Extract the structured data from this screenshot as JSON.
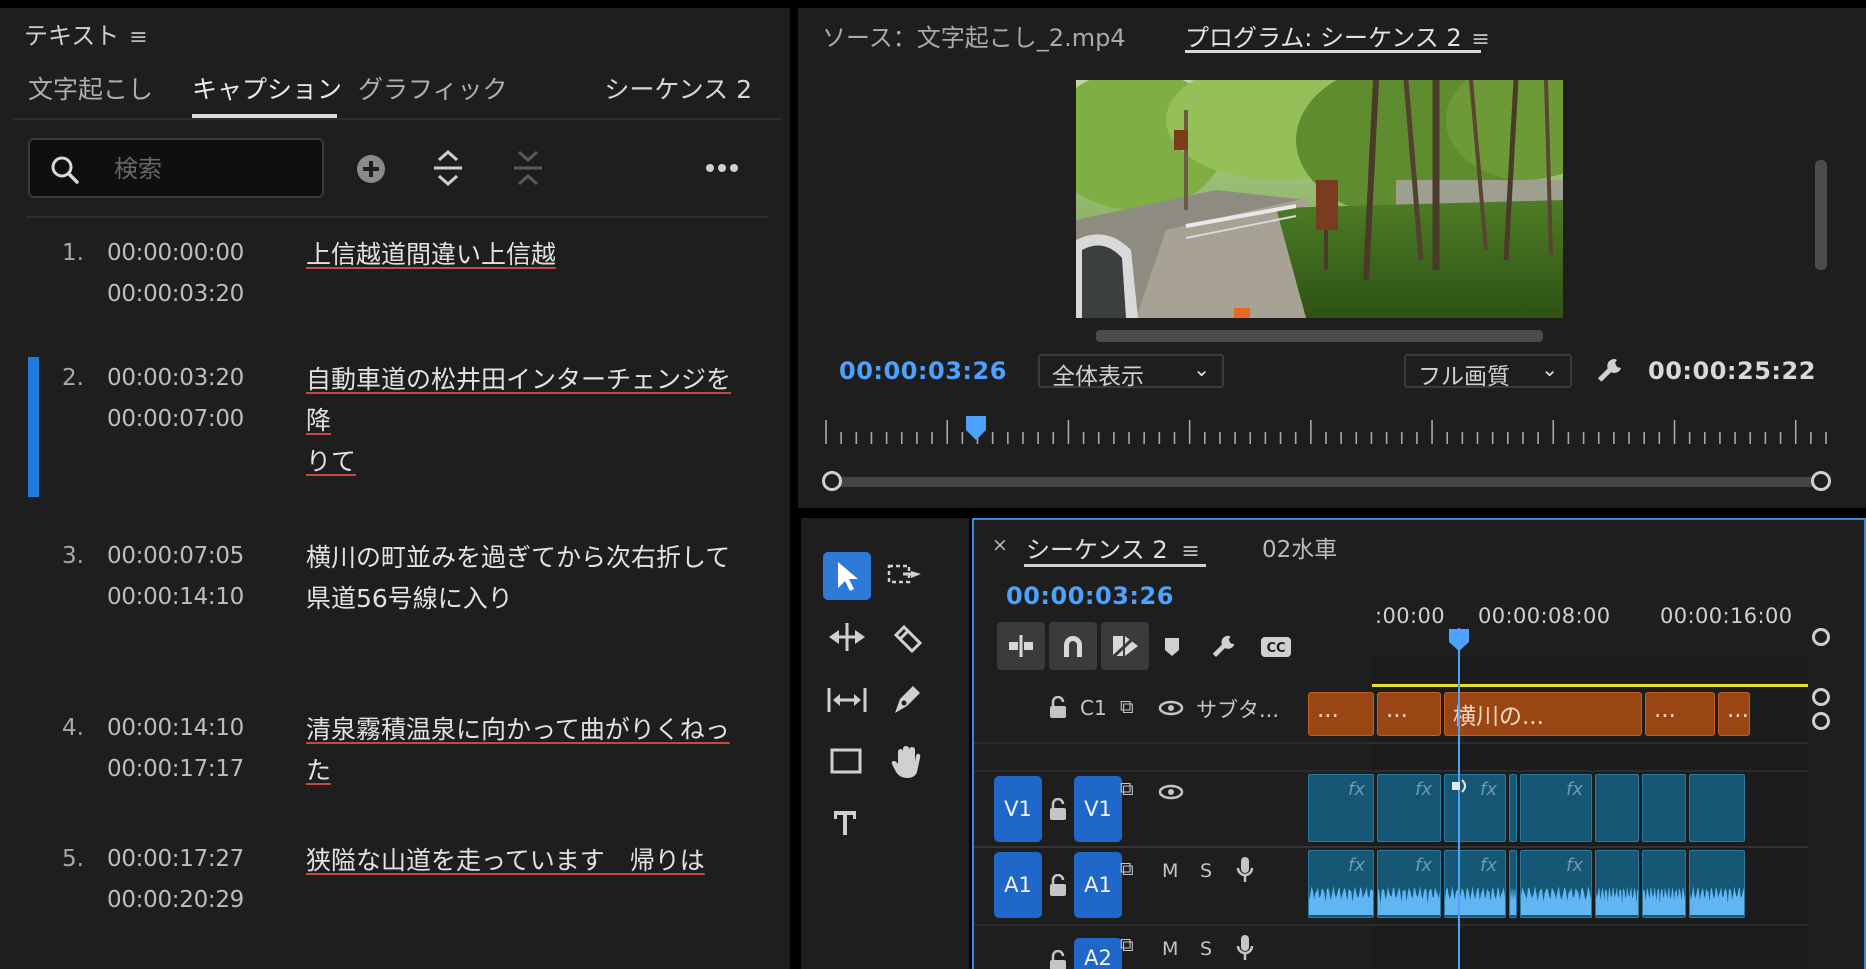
{
  "text_panel": {
    "title": "テキスト",
    "tabs": [
      "文字起こし",
      "キャプション",
      "グラフィック"
    ],
    "active_tab": "キャプション",
    "sequence_name": "シーケンス 2",
    "search": {
      "placeholder": "検索",
      "value": ""
    },
    "captions": [
      {
        "num": "1.",
        "start": "00:00:00:00",
        "end": "00:00:03:20",
        "lines": [
          "上信越道間違い上信越"
        ],
        "underlined": true,
        "selected": false
      },
      {
        "num": "2.",
        "start": "00:00:03:20",
        "end": "00:00:07:00",
        "lines": [
          "自動車道の松井田インターチェンジを降",
          "りて"
        ],
        "underlined": true,
        "selected": true
      },
      {
        "num": "3.",
        "start": "00:00:07:05",
        "end": "00:00:14:10",
        "lines": [
          "横川の町並みを過ぎてから次右折して",
          "県道56号線に入り"
        ],
        "underlined": false,
        "selected": false
      },
      {
        "num": "4.",
        "start": "00:00:14:10",
        "end": "00:00:17:17",
        "lines": [
          "清泉霧積温泉に向かって曲がりくねった"
        ],
        "underlined": true,
        "selected": false
      },
      {
        "num": "5.",
        "start": "00:00:17:27",
        "end": "00:00:20:29",
        "lines": [
          "狭隘な山道を走っています　帰りは"
        ],
        "underlined": true,
        "selected": false
      }
    ]
  },
  "program_monitor": {
    "source_tab": "ソース：文字起こし_2.mp4",
    "program_tab": "プログラム: シーケンス 2",
    "current_tc": "00:00:03:26",
    "zoom": "全体表示",
    "quality": "フル画質",
    "duration_tc": "00:00:25:22",
    "playhead_fraction": 0.15
  },
  "timeline": {
    "tab_name": "シーケンス 2",
    "other_tab": "02水車",
    "current_tc": "00:00:03:26",
    "ruler_labels": [
      ":00:00",
      "00:00:08:00",
      "00:00:16:00"
    ],
    "caption_track": {
      "name": "C1",
      "label": "サブタ..."
    },
    "caption_clips": [
      "...",
      "...",
      "横川の...",
      "...",
      "..."
    ],
    "video_track": {
      "source": "V1",
      "target": "V1"
    },
    "audio_tracks": [
      {
        "source": "A1",
        "target": "A1",
        "m": "M",
        "s": "S"
      },
      {
        "target": "A2",
        "m": "M",
        "s": "S"
      }
    ],
    "fx_label": "fx"
  },
  "colors": {
    "accent": "#1f7ae0",
    "timecode": "#4ea2ff",
    "caption_clip": "#9a4614",
    "media_clip": "#155774",
    "spellcheck_underline": "#c24a3e"
  }
}
